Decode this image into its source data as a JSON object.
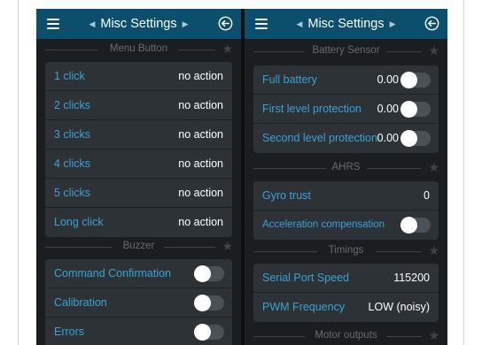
{
  "left_screen": {
    "title": "Misc Settings",
    "sections": {
      "menu_button": "Menu Button",
      "buzzer": "Buzzer"
    },
    "menu_button_rows": [
      {
        "label": "1 click",
        "value": "no action"
      },
      {
        "label": "2 clicks",
        "value": "no action"
      },
      {
        "label": "3 clicks",
        "value": "no action"
      },
      {
        "label": "4 clicks",
        "value": "no action"
      },
      {
        "label": "5 clicks",
        "value": "no action"
      },
      {
        "label": "Long click",
        "value": "no action"
      }
    ],
    "buzzer_rows": [
      {
        "label": "Command Confirmation",
        "enabled": false
      },
      {
        "label": "Calibration",
        "enabled": false
      },
      {
        "label": "Errors",
        "enabled": false
      }
    ]
  },
  "right_screen": {
    "title": "Misc Settings",
    "sections": {
      "battery_sensor": "Battery Sensor",
      "ahrs": "AHRS",
      "timings": "Timings",
      "motor_outputs": "Motor outputs"
    },
    "battery_rows": [
      {
        "label": "Full battery",
        "value": "0.00",
        "enabled": false
      },
      {
        "label": "First level protection",
        "value": "0.00",
        "enabled": false
      },
      {
        "label": "Second level protection",
        "value": "0.00",
        "enabled": false
      }
    ],
    "ahrs_rows": {
      "gyro_trust": {
        "label": "Gyro trust",
        "value": "0"
      },
      "accel_comp": {
        "label": "Acceleration compensation",
        "enabled": false
      }
    },
    "timings_rows": [
      {
        "label": "Serial Port Speed",
        "value": "115200"
      },
      {
        "label": "PWM Frequency",
        "value": "LOW (noisy)"
      }
    ]
  },
  "icons": {
    "menu": "hamburger-menu-icon",
    "prev": "triangle-left-icon",
    "next": "triangle-right-icon",
    "back": "circle-arrow-back-icon",
    "section_star": "star-icon"
  },
  "colors": {
    "topbar": "#0b4f6c",
    "background": "#1a1e21",
    "row_background": "#2d3237",
    "label_blue": "#3aa2d4",
    "value_white": "#ffffff",
    "section_text": "#646c72"
  }
}
